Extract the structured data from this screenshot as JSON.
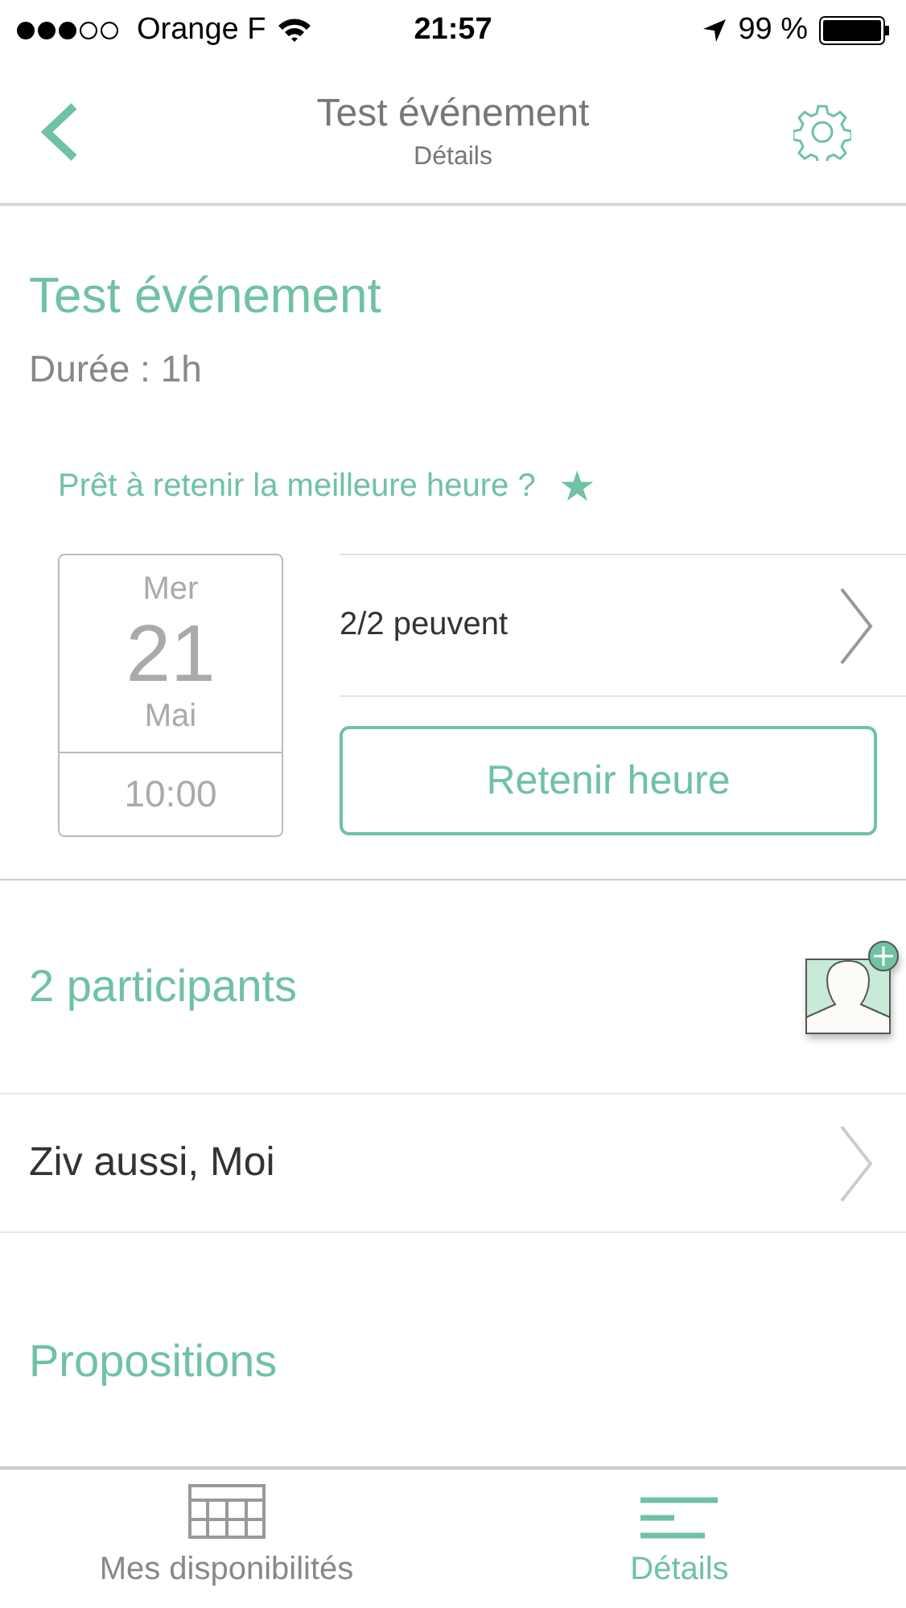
{
  "status_bar": {
    "carrier": "Orange F",
    "time": "21:57",
    "battery": "99 %"
  },
  "nav": {
    "title": "Test événement",
    "subtitle": "Détails"
  },
  "event": {
    "title": "Test événement",
    "duration": "Durée : 1h"
  },
  "best_time": {
    "prompt": "Prêt à retenir la meilleure heure ?",
    "star": "★",
    "date": {
      "weekday": "Mer",
      "day": "21",
      "month": "Mai",
      "time": "10:00"
    },
    "availability": "2/2 peuvent",
    "button": "Retenir heure"
  },
  "participants": {
    "title": "2 participants",
    "names": "Ziv aussi, Moi"
  },
  "proposals": {
    "title": "Propositions"
  },
  "tabs": [
    {
      "label": "Mes disponibilités",
      "kind": "calendar",
      "selected": false
    },
    {
      "label": "Détails",
      "kind": "list",
      "selected": true
    }
  ]
}
